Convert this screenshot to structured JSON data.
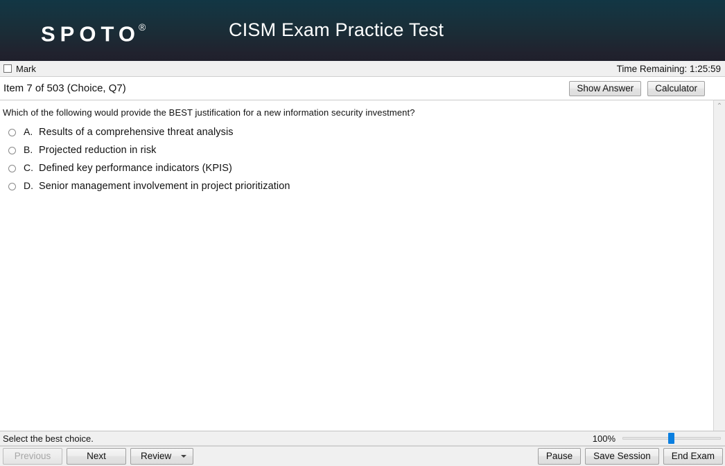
{
  "header": {
    "logo_text": "SPOTO",
    "logo_reg": "®",
    "title": "CISM Exam Practice Test",
    "gradient_top": "#123644",
    "gradient_bottom": "#1f202c"
  },
  "markbar": {
    "mark_label": "Mark",
    "timer_label": "Time Remaining: 1:25:59"
  },
  "itembar": {
    "item_label": "Item 7 of 503 (Choice, Q7)",
    "show_answer_label": "Show Answer",
    "calculator_label": "Calculator"
  },
  "question": {
    "stem": "Which of the following would provide the BEST justification for a new information security investment?",
    "options": [
      {
        "letter": "A.",
        "text": "Results of a comprehensive threat analysis",
        "selected": false
      },
      {
        "letter": "B.",
        "text": "Projected reduction in risk",
        "selected": false
      },
      {
        "letter": "C.",
        "text": "Defined key performance indicators (KPIS)",
        "selected": false
      },
      {
        "letter": "D.",
        "text": "Senior management involvement in project prioritization",
        "selected": false
      }
    ]
  },
  "scrollbar": {
    "up_arrow_glyph": "⌃"
  },
  "statusbar": {
    "status_text": "Select the best choice.",
    "zoom_level": "100%"
  },
  "toolbar": {
    "previous_label": "Previous",
    "next_label": "Next",
    "review_label": "Review",
    "pause_label": "Pause",
    "save_session_label": "Save Session",
    "end_exam_label": "End Exam"
  }
}
